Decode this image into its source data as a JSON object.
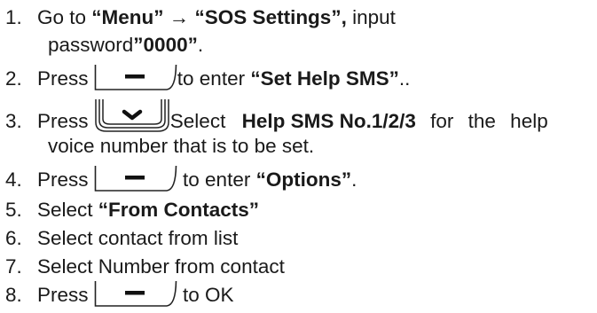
{
  "steps": [
    {
      "num": "1.",
      "pre": "Go to ",
      "b1": "“Menu” → “SOS Settings”,",
      "mid": " input",
      "line2_pre": "password",
      "line2_bold": "”0000”",
      "line2_post": "."
    },
    {
      "num": "2.",
      "pre": "Press",
      "post": "to enter ",
      "bold": "“Set Help SMS”",
      "tail": ".."
    },
    {
      "num": "3.",
      "pre": "Press",
      "post": "Select ",
      "bold": "Help SMS No.1/2/3",
      "tail": " for the help",
      "line2": "voice number that is to be set."
    },
    {
      "num": "4.",
      "pre": "Press",
      "post": " to enter ",
      "bold": "“Options”",
      "tail": "."
    },
    {
      "num": "5.",
      "pre": "Select ",
      "bold": "“From Contacts”"
    },
    {
      "num": "6.",
      "text": "Select contact from list"
    },
    {
      "num": "7.",
      "text": "Select Number from contact"
    },
    {
      "num": "8.",
      "pre": "Press",
      "post": " to OK"
    }
  ],
  "icons": {
    "softkey": "softkey-minus-icon",
    "navkey": "nav-down-key-icon"
  }
}
